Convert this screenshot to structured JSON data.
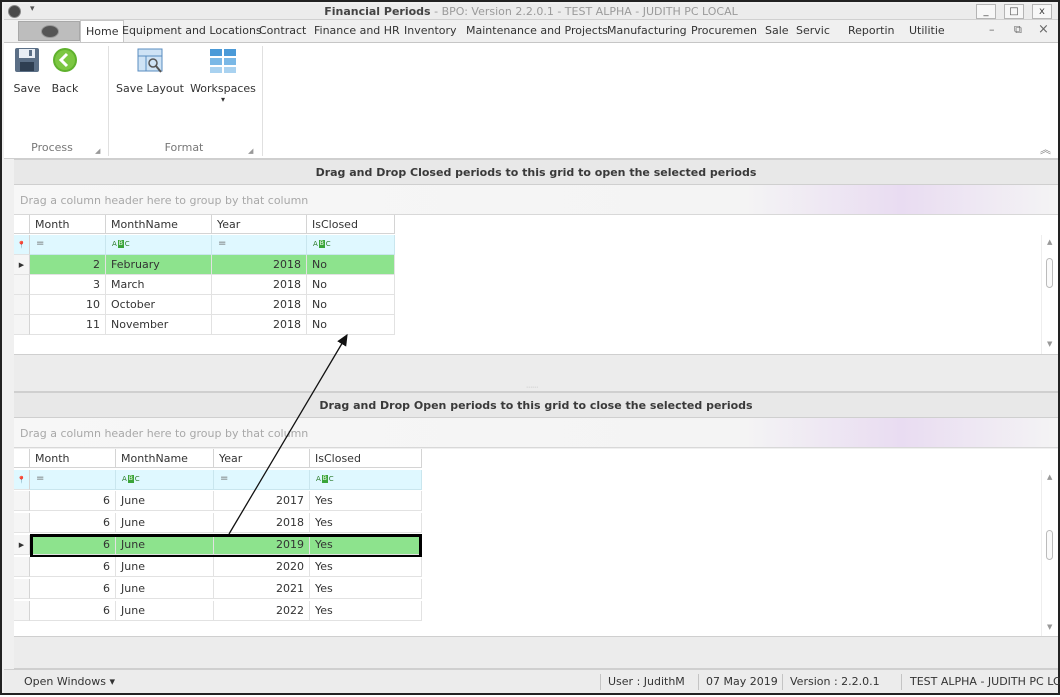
{
  "window": {
    "title_main": "Financial Periods",
    "title_rest": " - BPO: Version 2.2.0.1 - TEST ALPHA - JUDITH PC LOCAL",
    "minimize": "_",
    "restore": "□",
    "close": "x"
  },
  "ribbon": {
    "tabs": [
      "Home",
      "Equipment and Locations",
      "Contract",
      "Finance and HR",
      "Inventory",
      "Maintenance and Projects",
      "Manufacturing",
      "Procuremen",
      "Sale",
      "Servic",
      "Reportin",
      "Utilitie"
    ],
    "mdi_min": "–",
    "mdi_restore": "⧉",
    "mdi_close": "×",
    "collapse": "︽",
    "process": {
      "label": "Process",
      "save": "Save",
      "back": "Back"
    },
    "format": {
      "label": "Format",
      "save_layout": "Save Layout",
      "workspaces": "Workspaces"
    }
  },
  "closed_grid": {
    "banner": "Drag and Drop Closed periods to this grid to open the selected periods",
    "group_hint": "Drag a column header here to group by that column",
    "columns": [
      "Month",
      "MonthName",
      "Year",
      "IsClosed"
    ],
    "rows": [
      {
        "month": "2",
        "name": "February",
        "year": "2018",
        "closed": "No"
      },
      {
        "month": "3",
        "name": "March",
        "year": "2018",
        "closed": "No"
      },
      {
        "month": "10",
        "name": "October",
        "year": "2018",
        "closed": "No"
      },
      {
        "month": "11",
        "name": "November",
        "year": "2018",
        "closed": "No"
      }
    ],
    "selected_row": 0
  },
  "open_grid": {
    "banner": "Drag and Drop Open periods to this grid to close the selected periods",
    "group_hint": "Drag a column header here to group by that column",
    "columns": [
      "Month",
      "MonthName",
      "Year",
      "IsClosed"
    ],
    "rows": [
      {
        "month": "6",
        "name": "June",
        "year": "2017",
        "closed": "Yes"
      },
      {
        "month": "6",
        "name": "June",
        "year": "2018",
        "closed": "Yes"
      },
      {
        "month": "6",
        "name": "June",
        "year": "2019",
        "closed": "Yes"
      },
      {
        "month": "6",
        "name": "June",
        "year": "2020",
        "closed": "Yes"
      },
      {
        "month": "6",
        "name": "June",
        "year": "2021",
        "closed": "Yes"
      },
      {
        "month": "6",
        "name": "June",
        "year": "2022",
        "closed": "Yes"
      }
    ],
    "selected_row": 2
  },
  "filter_equals": "=",
  "statusbar": {
    "open_windows": "Open Windows ▾",
    "user": "User : JudithM",
    "date": "07 May 2019",
    "version": "Version : 2.2.0.1",
    "env": "TEST ALPHA - JUDITH PC LOCAL"
  },
  "colors": {
    "selected_row": "#8de38d",
    "highlight_border": "#000000",
    "filter_row": "#dff8ff"
  }
}
